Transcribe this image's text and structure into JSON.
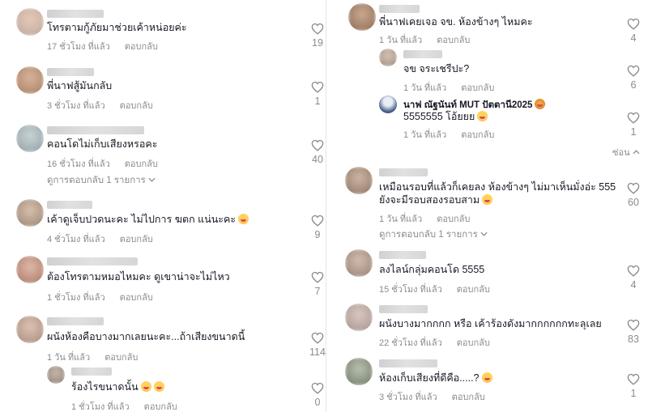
{
  "left_comments": [
    {
      "text": "โทรตามกู้ภัยมาช่วยเค้าหน่อยค่ะ",
      "time": "17 ชั่วโมง ที่แล้ว",
      "reply": "ตอบกลับ",
      "likes": "19"
    },
    {
      "text": "พี่นาฟสู้มันกลับ",
      "time": "3 ชั่วโมง ที่แล้ว",
      "reply": "ตอบกลับ",
      "likes": "1"
    },
    {
      "text": "คอนโดไม่เก็บเสียงหรอคะ",
      "time": "16 ชั่วโมง ที่แล้ว",
      "reply": "ตอบกลับ",
      "likes": "40",
      "view_replies": "ดูการตอบกลับ 1 รายการ"
    },
    {
      "text": "เค้าดูเจ็บปวดนะคะ ไม่ไปการ ฆตก แน่นะคะ",
      "time": "4 ชั่วโมง ที่แล้ว",
      "reply": "ตอบกลับ",
      "likes": "9"
    },
    {
      "text": "ต้องโทรตามหมอไหมคะ ดูเขาน่าจะไม่ไหว",
      "time": "1 ชั่วโมง ที่แล้ว",
      "reply": "ตอบกลับ",
      "likes": "7"
    },
    {
      "text": "ผนังห้องคือบางมากเลยนะคะ...ถ้าเสียงขนาดนี้",
      "time": "1 วัน ที่แล้ว",
      "reply": "ตอบกลับ",
      "likes": "114"
    },
    {
      "text": "ร้องไรขนาดนั้น",
      "time": "1 ชั่วโมง ที่แล้ว",
      "reply": "ตอบกลับ",
      "likes": "0"
    }
  ],
  "right_comments": [
    {
      "text": "พี่นาฟเคยเจอ จข. ห้องข้างๆ ไหมคะ",
      "time": "1 วัน ที่แล้ว",
      "reply": "ตอบกลับ",
      "likes": "4"
    },
    {
      "text": "จข จระเชรีปะ?",
      "time": "1 วัน ที่แล้ว",
      "reply": "ตอบกลับ",
      "likes": "6"
    },
    {
      "name": "นาฟ ณัฐนันท์ MUT ปัตตานี2025",
      "text": "5555555 โอ้ยยย",
      "time": "1 วัน ที่แล้ว",
      "reply": "ตอบกลับ",
      "likes": "1"
    },
    {
      "text_line1": "เหมือนรอบที่แล้วก็เคยลง ห้องข้างๆ ไม่มาเห็นมั่งอ่ะ 555",
      "text_line2": "ยังจะมีรอบสองรอบสาม",
      "time": "1 วัน ที่แล้ว",
      "reply": "ตอบกลับ",
      "likes": "60",
      "view_replies": "ดูการตอบกลับ 1 รายการ"
    },
    {
      "text": "ลงไลน์กลุ่มคอนโด 5555",
      "time": "15 ชั่วโมง ที่แล้ว",
      "reply": "ตอบกลับ",
      "likes": "4"
    },
    {
      "text": "ผนังบางมากกกก หรือ เค้าร้องดังมากกกกกกทะลุเลย",
      "time": "22 ชั่วโมง ที่แล้ว",
      "reply": "ตอบกลับ",
      "likes": "83"
    },
    {
      "text": "ห้องเก็บเสียงที่ดีคือ.....?",
      "time": "3 ชั่วโมง ที่แล้ว",
      "reply": "ตอบกลับ",
      "likes": "1"
    }
  ],
  "hide_label": "ซ่อน",
  "icons": {
    "like": "heart-outline-icon",
    "chevron": "chevron-down-icon",
    "emoji": "laughing-emoji-icon"
  },
  "colors": {
    "text": "#161823",
    "meta": "#8a8b91",
    "background": "#ffffff"
  }
}
